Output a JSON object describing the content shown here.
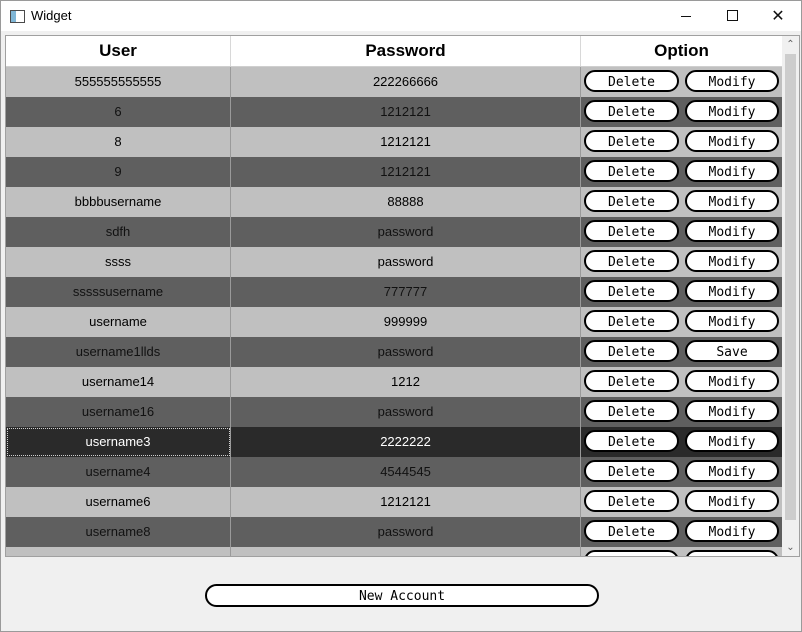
{
  "window": {
    "title": "Widget",
    "icon": "app-window-icon"
  },
  "table": {
    "headers": {
      "user": "User",
      "password": "Password",
      "option": "Option"
    },
    "rows": [
      {
        "user": "555555555555",
        "password": "222266666",
        "delete": "Delete",
        "action": "Modify"
      },
      {
        "user": "6",
        "password": "1212121",
        "delete": "Delete",
        "action": "Modify"
      },
      {
        "user": "8",
        "password": "1212121",
        "delete": "Delete",
        "action": "Modify"
      },
      {
        "user": "9",
        "password": "1212121",
        "delete": "Delete",
        "action": "Modify"
      },
      {
        "user": "bbbbusername",
        "password": "88888",
        "delete": "Delete",
        "action": "Modify"
      },
      {
        "user": "sdfh",
        "password": "password",
        "delete": "Delete",
        "action": "Modify"
      },
      {
        "user": "ssss",
        "password": "password",
        "delete": "Delete",
        "action": "Modify"
      },
      {
        "user": "sssssusername",
        "password": "777777",
        "delete": "Delete",
        "action": "Modify"
      },
      {
        "user": "username",
        "password": "999999",
        "delete": "Delete",
        "action": "Modify"
      },
      {
        "user": "username1llds",
        "password": "password",
        "delete": "Delete",
        "action": "Save"
      },
      {
        "user": "username14",
        "password": "1212",
        "delete": "Delete",
        "action": "Modify"
      },
      {
        "user": "username16",
        "password": "password",
        "delete": "Delete",
        "action": "Modify"
      },
      {
        "user": "username3",
        "password": "2222222",
        "delete": "Delete",
        "action": "Modify",
        "selected": true
      },
      {
        "user": "username4",
        "password": "4544545",
        "delete": "Delete",
        "action": "Modify"
      },
      {
        "user": "username6",
        "password": "1212121",
        "delete": "Delete",
        "action": "Modify"
      },
      {
        "user": "username8",
        "password": "password",
        "delete": "Delete",
        "action": "Modify"
      },
      {
        "user": "",
        "password": "",
        "delete": "",
        "action": ""
      }
    ]
  },
  "footer": {
    "new_account_label": "New Account"
  },
  "colors": {
    "row_light": "#c0c0c0",
    "row_dark": "#5f5f5f",
    "row_selected": "#2a2a2a"
  }
}
